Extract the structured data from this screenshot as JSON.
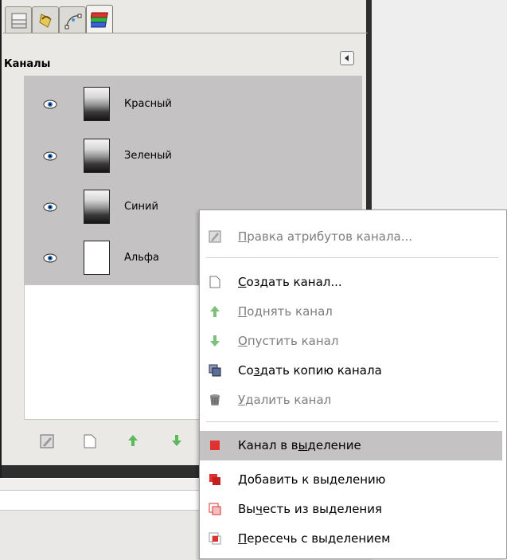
{
  "panel": {
    "title": "Каналы",
    "channels": [
      {
        "label": "Красный",
        "thumb": "photo"
      },
      {
        "label": "Зеленый",
        "thumb": "photo"
      },
      {
        "label": "Синий",
        "thumb": "photo"
      },
      {
        "label": "Альфа",
        "thumb": "white"
      }
    ]
  },
  "tabs": [
    {
      "icon": "layers-icon"
    },
    {
      "icon": "undo-history-icon"
    },
    {
      "icon": "paths-icon"
    },
    {
      "icon": "channels-icon",
      "active": true
    }
  ],
  "bottom_bar": {
    "icons": [
      "edit-attributes-icon",
      "new-channel-icon",
      "raise-icon",
      "lower-icon"
    ]
  },
  "context_menu": {
    "items": [
      {
        "pre": "",
        "u": "П",
        "post": "равка атрибутов канала...",
        "icon": "edit-attributes-icon",
        "disabled": true
      },
      {
        "pre": "",
        "u": "С",
        "post": "оздать канал...",
        "icon": "new-channel-icon",
        "disabled": false
      },
      {
        "pre": "",
        "u": "П",
        "post": "однять канал",
        "icon": "raise-icon",
        "disabled": true
      },
      {
        "pre": "",
        "u": "О",
        "post": "пустить канал",
        "icon": "lower-icon",
        "disabled": true
      },
      {
        "pre": "Со",
        "u": "з",
        "post": "дать копию канала",
        "icon": "duplicate-icon",
        "disabled": false
      },
      {
        "pre": "",
        "u": "У",
        "post": "далить канал",
        "icon": "delete-icon",
        "disabled": true
      },
      {
        "pre": "Канал в в",
        "u": "ы",
        "post": "деление",
        "icon": "channel-to-selection-icon",
        "disabled": false,
        "highlighted": true
      },
      {
        "pre": "",
        "u": "Д",
        "post": "обавить к выделению",
        "icon": "add-to-selection-icon",
        "disabled": false
      },
      {
        "pre": "Вы",
        "u": "ч",
        "post": "есть из выделения",
        "icon": "subtract-selection-icon",
        "disabled": false
      },
      {
        "pre": "",
        "u": "П",
        "post": "ересечь с выделением",
        "icon": "intersect-selection-icon",
        "disabled": false
      }
    ]
  },
  "colors": {
    "list_bg": "#c4c2c2",
    "highlight": "#c4c2c2",
    "selection_red": "#e03030"
  }
}
